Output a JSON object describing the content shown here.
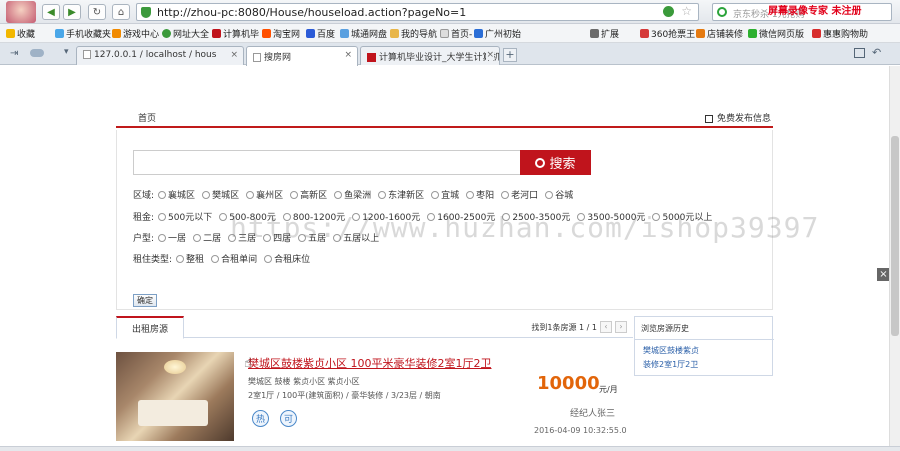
{
  "browser": {
    "address": "http://zhou-pc:8080/House/houseload.action?pageNo=1",
    "search_placeholder": "京东秒杀 1元抢购",
    "recorder_mark": "屏幕录像专家  未注册",
    "bookmarks": [
      "收藏",
      "手机收藏夹",
      "游戏中心",
      "网址大全",
      "计算机毕",
      "淘宝网",
      "百度",
      "城通网盘",
      "我的导航",
      "首页-",
      "广州初始",
      "扩展",
      "360抢票王",
      "店铺装修",
      "微信网页版",
      "惠惠购物助"
    ],
    "tabs": [
      {
        "label": "127.0.0.1 / localhost / hous",
        "active": false
      },
      {
        "label": "搜房网",
        "active": true
      },
      {
        "label": "计算机毕业设计_大学生计算机",
        "active": false
      }
    ],
    "colors": {
      "accent": "#c0141c",
      "price": "#e2650a",
      "link": "#2a5fa8"
    }
  },
  "site": {
    "nav_home": "首页",
    "publish": "免费发布信息",
    "search_button": "搜索",
    "watermark": "https://www.huzhan.com/ishop39397",
    "filters": {
      "district_label": "区域:",
      "districts": [
        "襄城区",
        "樊城区",
        "襄州区",
        "高新区",
        "鱼梁洲",
        "东津新区",
        "宜城",
        "枣阳",
        "老河口",
        "谷城"
      ],
      "rent_label": "租金:",
      "rents": [
        "500元以下",
        "500-800元",
        "800-1200元",
        "1200-1600元",
        "1600-2500元",
        "2500-3500元",
        "3500-5000元",
        "5000元以上"
      ],
      "layout_label": "户型:",
      "layouts": [
        "一居",
        "二居",
        "三居",
        "四居",
        "五居",
        "五居以上"
      ],
      "type_label": "租住类型:",
      "types": [
        "整租",
        "合租单间",
        "合租床位"
      ],
      "confirm": "确定"
    },
    "results": {
      "tab": "出租房源",
      "pager_text": "找到1条房源 1 / 1",
      "listing": {
        "title": "樊城区鼓楼紫贞小区 100平米豪华装修2室1厅2卫",
        "meta1": "樊城区   鼓楼   紫贞小区     紫贞小区",
        "meta2": "2室1厅 / 100平(建筑面积) / 豪华装修 / 3/23层 / 朝南",
        "price": "10000",
        "unit": "元/月",
        "agent": "经纪人张三",
        "date": "2016-04-09 10:32:55.0",
        "features": [
          "热",
          "可"
        ]
      }
    },
    "history": {
      "title": "浏览房源历史",
      "items": [
        "樊城区鼓楼紫贞",
        "装修2室1厅2卫"
      ]
    }
  }
}
